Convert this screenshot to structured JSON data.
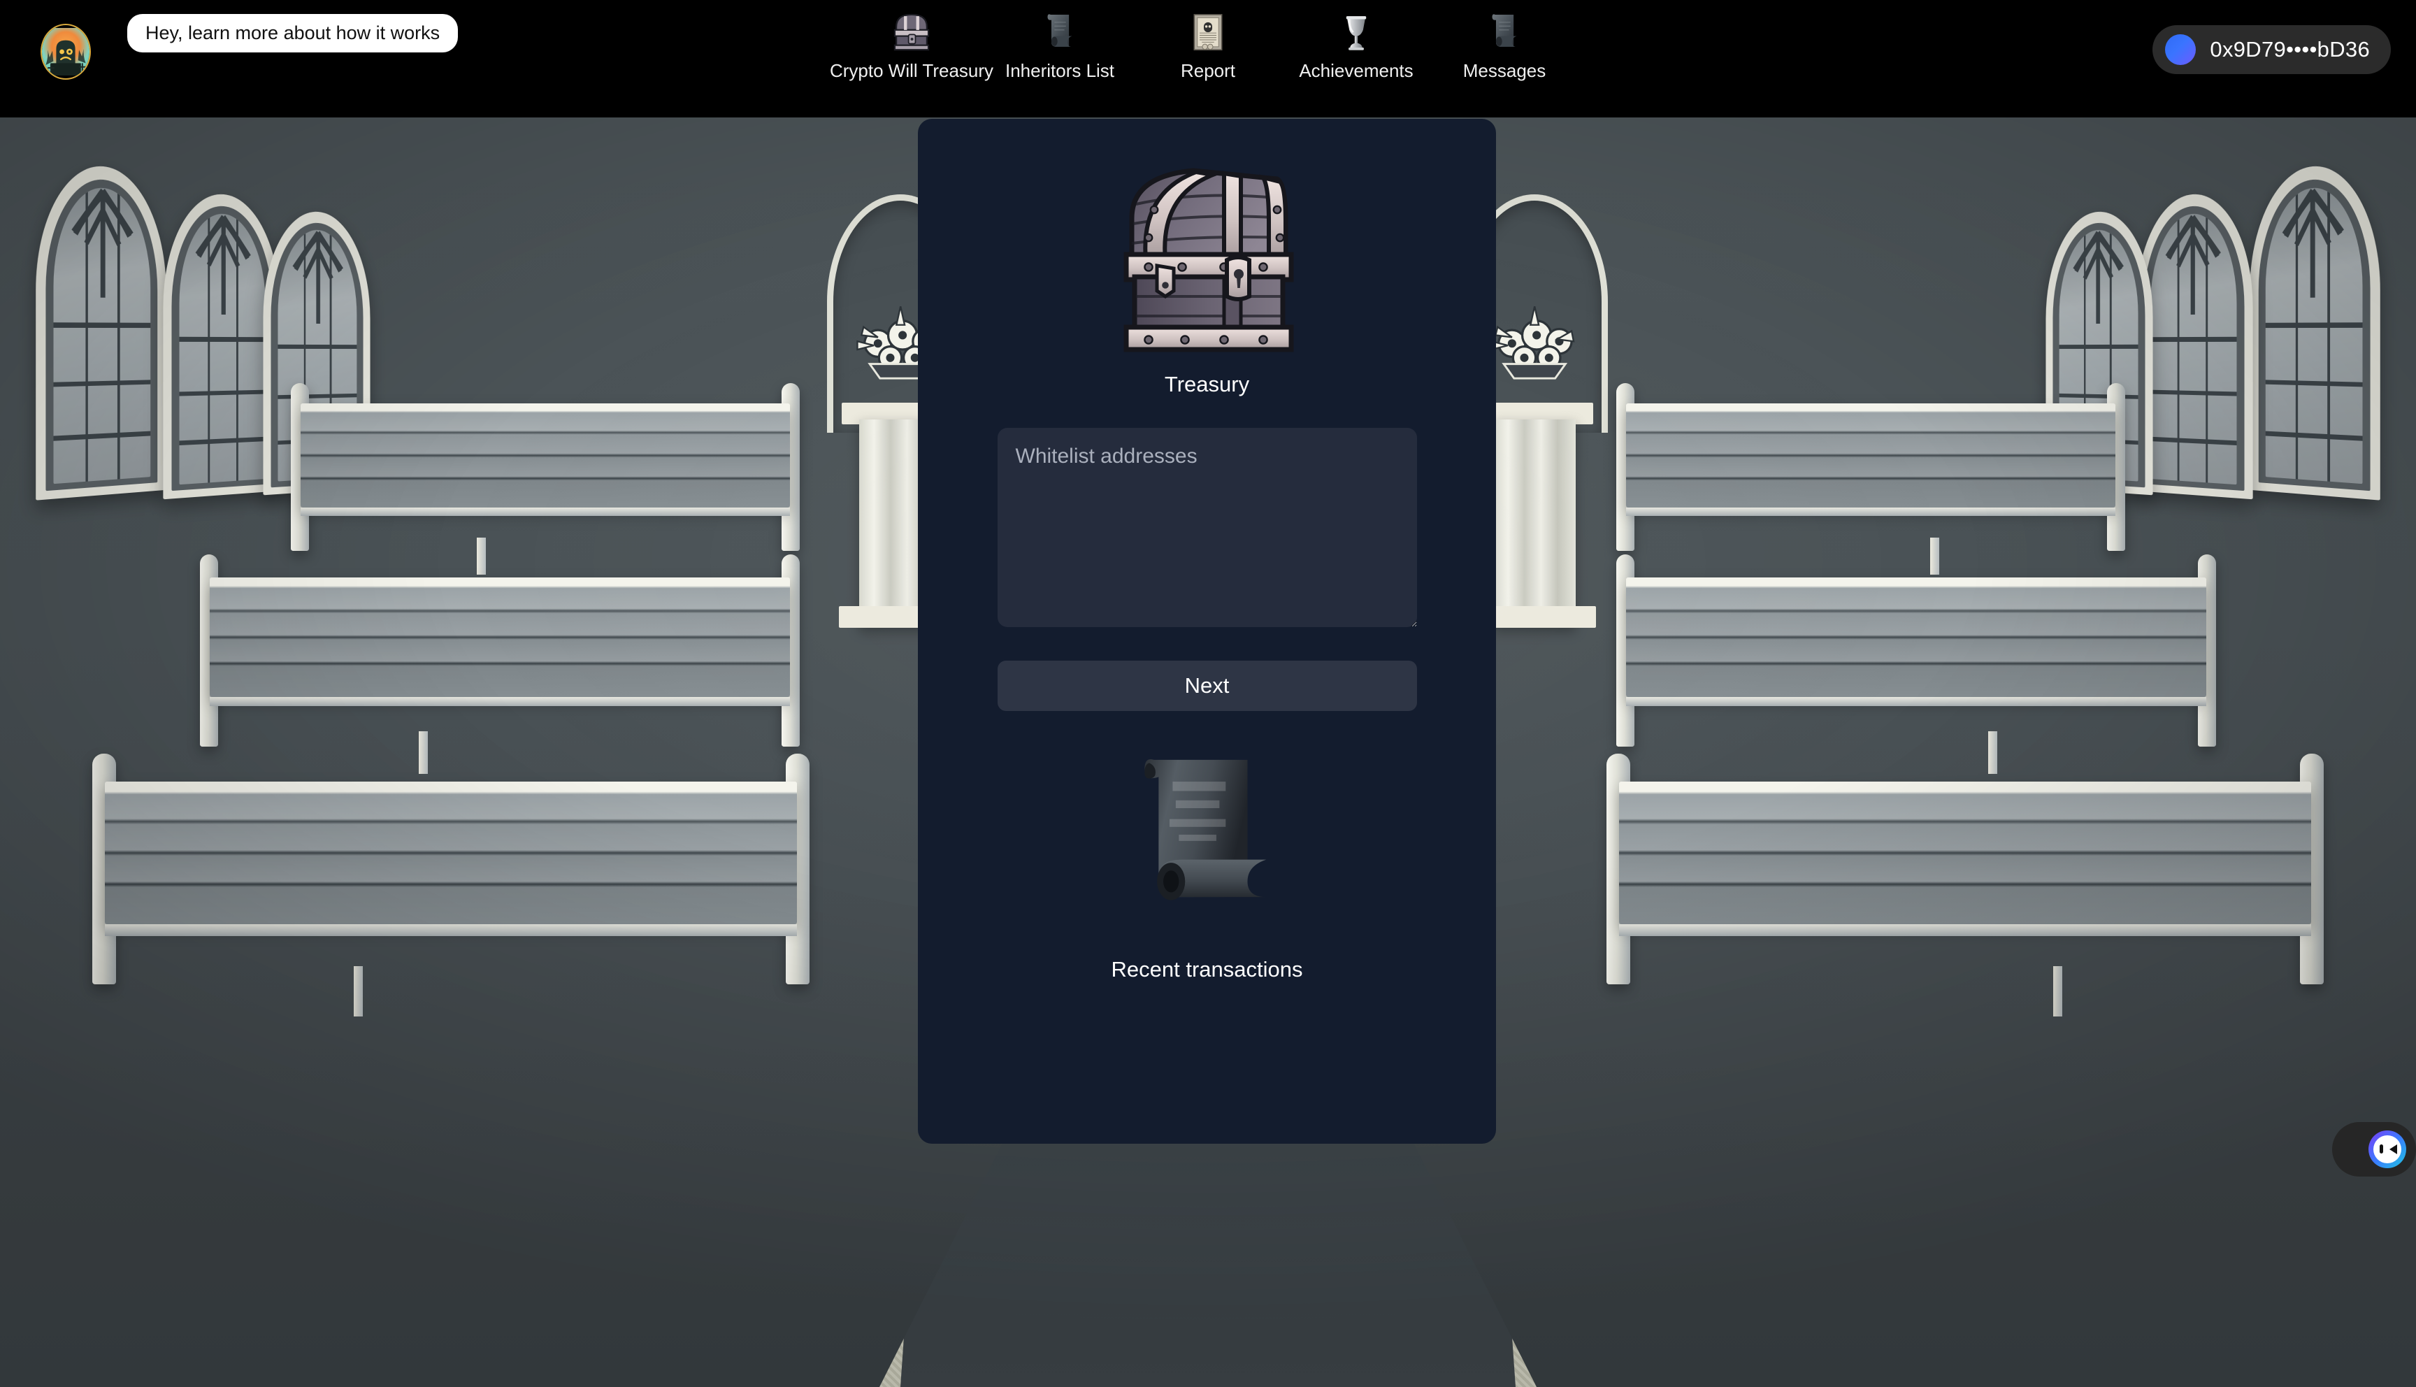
{
  "topbar": {
    "avatar_icon": "tombstone-avatar-icon",
    "tooltip_text": "Hey, learn more about how it works",
    "nav_items": [
      {
        "label": "Crypto Will Treasury",
        "icon": "treasure-chest-icon"
      },
      {
        "label": "Inheritors List",
        "icon": "scroll-icon"
      },
      {
        "label": "Report",
        "icon": "skull-certificate-icon"
      },
      {
        "label": "Achievements",
        "icon": "trophy-chalice-icon"
      },
      {
        "label": "Messages",
        "icon": "scroll-icon"
      }
    ],
    "wallet": {
      "address": "0x9D79••••bD36",
      "dot_color": "#3a74ff",
      "pill_color": "#2b2b2b"
    }
  },
  "panel": {
    "hero_icon": "treasure-chest-icon",
    "title": "Treasury",
    "whitelist": {
      "placeholder": "Whitelist addresses",
      "value": ""
    },
    "next_button_label": "Next",
    "transactions_icon": "scroll-icon",
    "transactions_label": "Recent transactions",
    "background_color": "#131c2e"
  },
  "chat_widget": {
    "icon": "winking-face-icon",
    "gradient_from": "#7b3cf5",
    "gradient_to": "#1fc6e0"
  },
  "scene": {
    "description": "chapel-interior-background",
    "wall_color": "#4a5256",
    "window_count_left": 3,
    "window_count_right": 3,
    "pew_rows": 3,
    "aisle_carpet": true
  }
}
